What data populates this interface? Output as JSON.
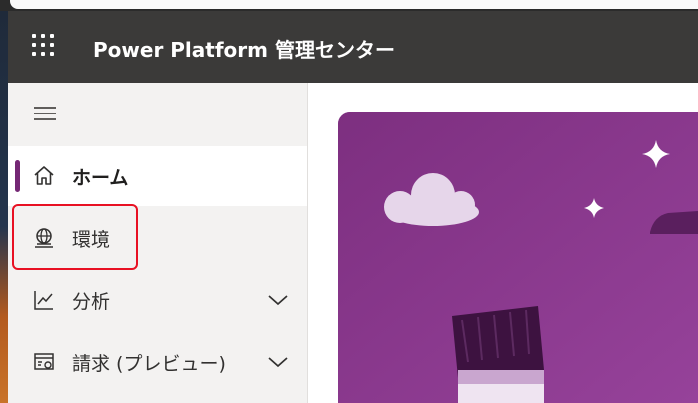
{
  "header": {
    "app_title": "Power Platform 管理センター",
    "waffle_icon": "app-launcher-icon"
  },
  "sidebar": {
    "collapse_icon": "hamburger-icon",
    "items": [
      {
        "label": "ホーム",
        "icon": "home-icon",
        "selected": true
      },
      {
        "label": "環境",
        "icon": "environment-globe-icon",
        "selected": false
      },
      {
        "label": "分析",
        "icon": "analytics-chart-icon",
        "expandable": true
      },
      {
        "label": "請求 (プレビュー)",
        "icon": "billing-icon",
        "expandable": true
      }
    ]
  },
  "colors": {
    "header_bg": "#3b3a39",
    "sidebar_bg": "#f3f2f1",
    "accent": "#742774",
    "hero_bg": "#8a3a8c",
    "highlight": "#e81123"
  }
}
